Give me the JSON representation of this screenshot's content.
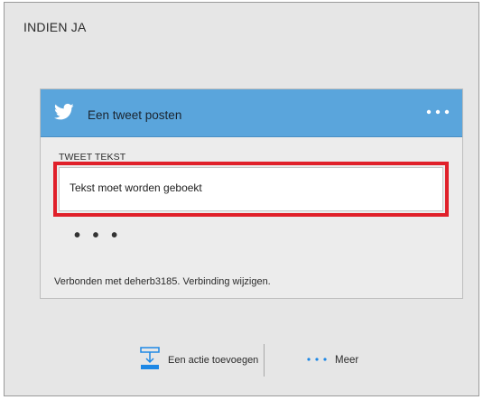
{
  "panel": {
    "title": "INDIEN JA"
  },
  "card": {
    "title": "Een tweet posten",
    "icon": "twitter-bird-icon",
    "menu_icon": "more-dots-icon",
    "field_label": "TWEET TEKST",
    "field_value": "Tekst moet worden geboekt",
    "ellipsis": "• • •",
    "connection_text": "Verbonden met deherb3185.",
    "connection_link": "Verbinding wijzigen."
  },
  "actions": {
    "add_action_label": "Een actie toevoegen",
    "add_action_icon": "add-action-icon",
    "more_label": "Meer",
    "more_icon": "more-dots-icon"
  },
  "colors": {
    "header": "#5aa5dc",
    "highlight": "#e0202a",
    "icon_blue": "#1e88e5",
    "background": "#e6e6e6"
  }
}
